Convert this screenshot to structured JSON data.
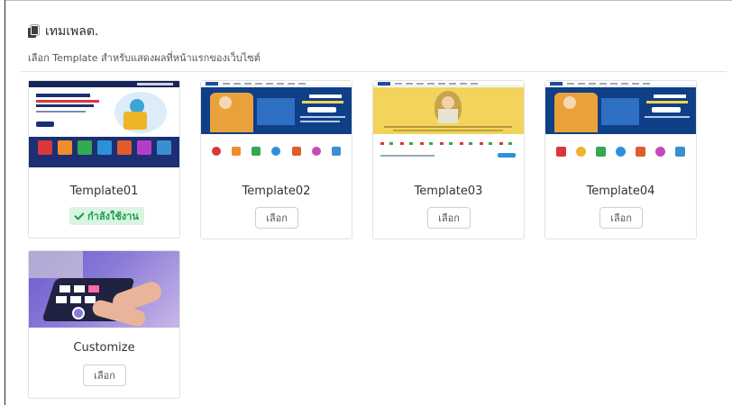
{
  "header": {
    "title": "เทมเพลต.",
    "subtitle": "เลือก Template สำหรับแสดงผลที่หน้าแรกของเว็บไซต์"
  },
  "templates": [
    {
      "name": "Template01",
      "status": "กำลังใช้งาน",
      "active": true
    },
    {
      "name": "Template02",
      "button": "เลือก",
      "active": false
    },
    {
      "name": "Template03",
      "button": "เลือก",
      "active": false
    },
    {
      "name": "Template04",
      "button": "เลือก",
      "active": false
    },
    {
      "name": "Customize",
      "button": "เลือก",
      "active": false
    }
  ],
  "colors": {
    "active_badge_bg": "#d8f4e2",
    "active_badge_text": "#1e9a4b",
    "template01_hero": "#1c2f73",
    "template02_hero": "#0f3f87",
    "template03_hero": "#f2d45c",
    "template04_hero": "#0f3f87"
  },
  "icons": {
    "header": "template-pages-icon",
    "active": "checkmark-icon"
  }
}
